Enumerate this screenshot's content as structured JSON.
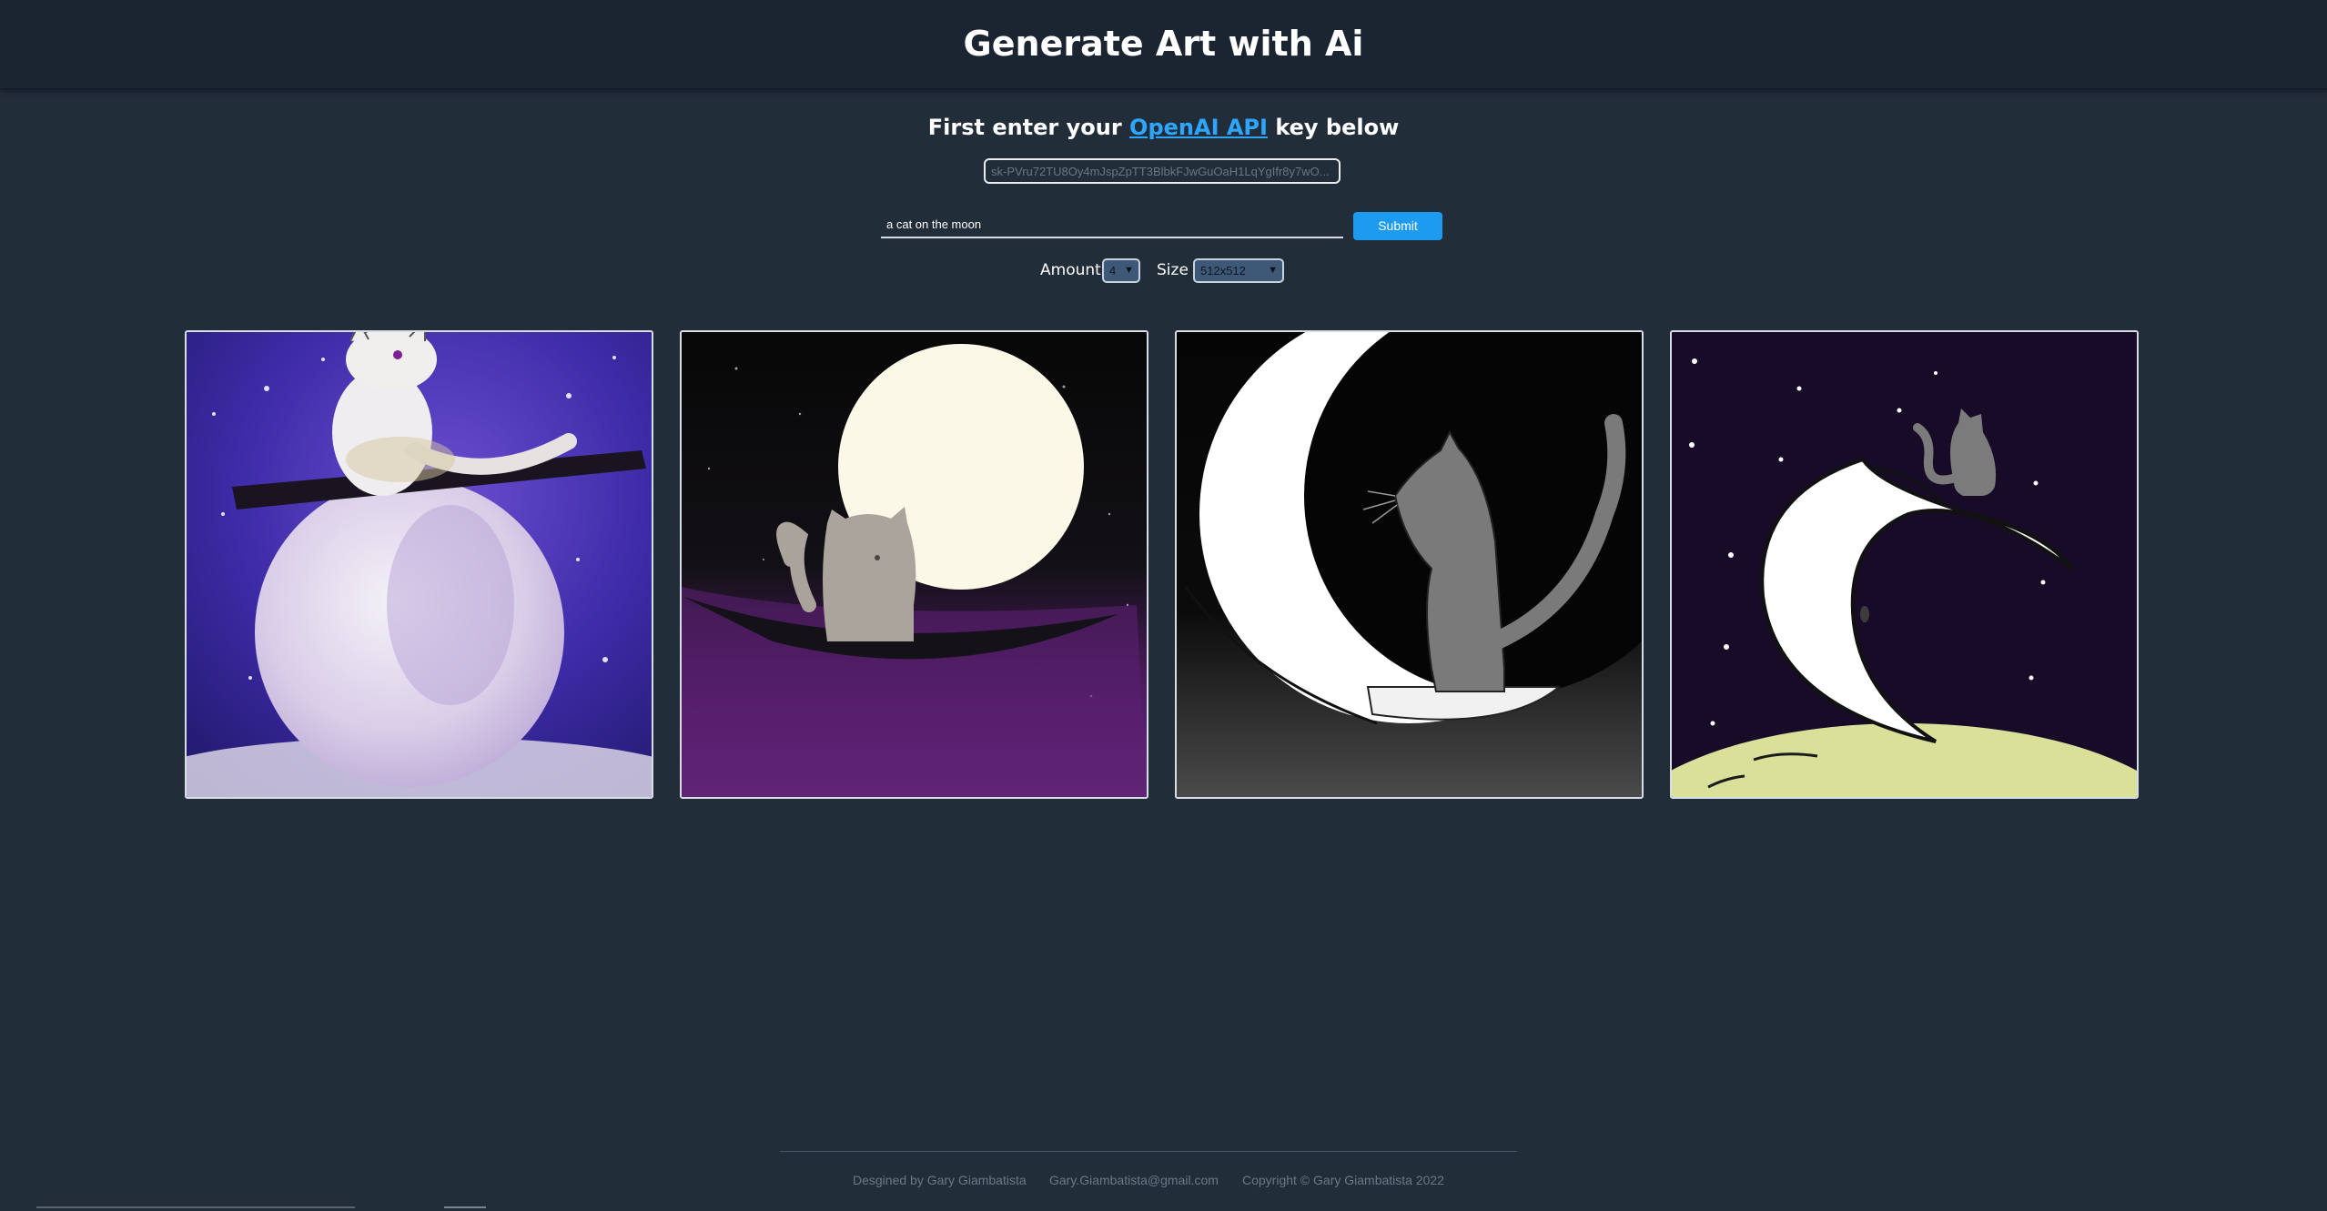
{
  "header": {
    "title": "Generate Art with Ai"
  },
  "api": {
    "heading_before": "First enter your",
    "link_text": "OpenAI API",
    "heading_after": "key below",
    "key_value": "sk-PVru72TU8Oy4mJspZpTT3BlbkFJwGuOaH1LqYgIfr8y7wO..."
  },
  "prompt": {
    "value": "a cat on the moon"
  },
  "submit": {
    "label": "Submit"
  },
  "options": {
    "amount_label": "Amount",
    "amount_value": "4",
    "size_label": "Size",
    "size_value": "512x512"
  },
  "gallery": {
    "images": [
      {
        "name": "generated-image-1"
      },
      {
        "name": "generated-image-2"
      },
      {
        "name": "generated-image-3"
      },
      {
        "name": "generated-image-4"
      }
    ]
  },
  "footer": {
    "designed_by": "Desgined by Gary Giambatista",
    "email": "Gary.Giambatista@gmail.com",
    "copyright": "Copyright © Gary Giambatista 2022"
  },
  "colors": {
    "background": "#222d3a",
    "header": "#1b2531",
    "accent": "#1d9bf0",
    "link": "#2ea6ff"
  }
}
